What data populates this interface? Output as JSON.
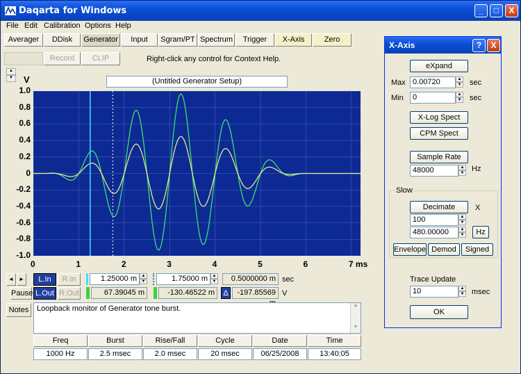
{
  "window": {
    "title": "Daqarta for Windows",
    "minimize": "_",
    "maximize": "□",
    "close": "X"
  },
  "menu": [
    "File",
    "Edit",
    "Calibration",
    "Options",
    "Help"
  ],
  "toolbar": [
    "Averager",
    "DDisk",
    "Generator",
    "Input",
    "Sgram/PT",
    "Spectrum",
    "Trigger",
    "X-Axis",
    "Zero"
  ],
  "record_label": "Record",
  "clip_label": "CLIP",
  "help_text": "Right-click any control for Context Help.",
  "setup_title": "(Untitled Generator Setup)",
  "plot": {
    "y_unit": "V",
    "y_ticks": [
      "1.0",
      "0.8",
      "0.6",
      "0.4",
      "0.2",
      "0",
      "-0.2",
      "-0.4",
      "-0.6",
      "-0.8",
      "-1.0"
    ],
    "x_ticks": [
      "0",
      "1",
      "2",
      "3",
      "4",
      "5",
      "6",
      "7 ms"
    ],
    "solid_cursor_ms": 1.25,
    "dotted_cursor_ms": 1.75,
    "colors": {
      "bg": "#0d2a94",
      "trace_in": "#e8e890",
      "trace_out": "#40e070",
      "grid": "#5e76c8",
      "cursor": "#40e0ff"
    }
  },
  "readouts": {
    "left_cursor_time": "1.25000 m",
    "right_cursor_time": "1.75000 m",
    "span_time": "0.5000000 m",
    "time_unit": "sec",
    "left_value": "67.39045 m",
    "right_value": "-130.46522 m",
    "delta_value": "-197.85569 m",
    "volt_unit": "V",
    "delta_symbol": "Δ"
  },
  "channel_buttons": {
    "lin": "L.In",
    "rin": "R.In",
    "pause": "Pause",
    "lout": "L.Out",
    "rout": "R.Out"
  },
  "notes": {
    "button": "Notes",
    "text": "Loopback monitor of Generator tone burst."
  },
  "table": {
    "headers": [
      "Freq",
      "Burst",
      "Rise/Fall",
      "Cycle",
      "Date",
      "Time"
    ],
    "values": [
      "1000 Hz",
      "2.5 msec",
      "2.0 msec",
      "20 msec",
      "06/25/2008",
      "13:40:05"
    ]
  },
  "xaxis_dialog": {
    "title": "X-Axis",
    "help": "?",
    "close": "X",
    "expand": "eXpand",
    "max_label": "Max",
    "max_value": "0.00720",
    "min_label": "Min",
    "min_value": "0",
    "unit": "sec",
    "xlog": "X-Log Spect",
    "cpm": "CPM Spect",
    "sample_rate_btn": "Sample Rate",
    "sample_rate": "48000",
    "hz": "Hz",
    "slow_group": "Slow",
    "decimate": "Decimate",
    "x_label": "X",
    "decimate_value": "100",
    "decimate_hz": "480.00000",
    "hz_btn": "Hz",
    "envelope": "Envelope",
    "demod": "Demod",
    "signed": "Signed",
    "trace_update_btn": "Trace Update",
    "trace_update_value": "10",
    "msec": "msec",
    "ok": "OK"
  }
}
